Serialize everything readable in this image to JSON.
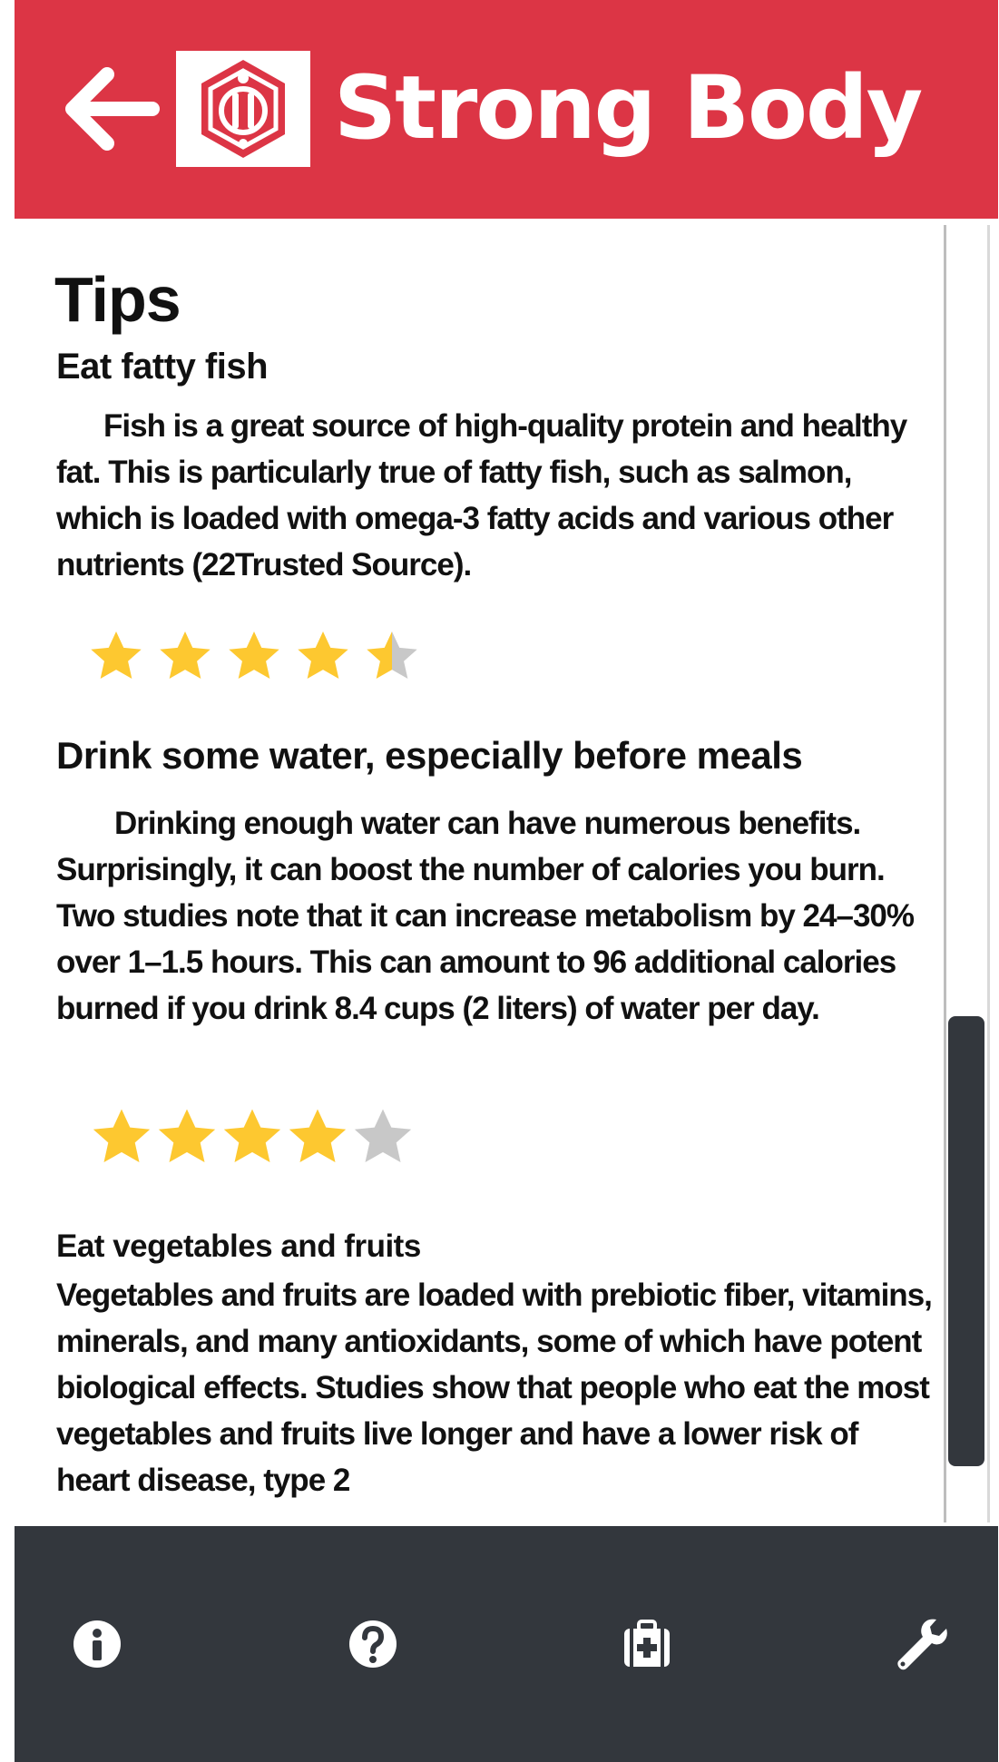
{
  "header": {
    "title": "Strong Body",
    "colors": {
      "bar": "#dc3545",
      "title": "#ffffff"
    },
    "icons": {
      "back": "arrow-left-icon",
      "logo": "strong-body-logo"
    }
  },
  "content": {
    "page_title": "Tips",
    "tips": [
      {
        "heading": "Eat fatty fish",
        "body": "Fish is a great source of high-quality protein and healthy fat. This is particularly true of fatty fish, such as salmon, which is loaded with omega-3 fatty acids and various other nutrients (22Trusted Source).",
        "rating": 4.5,
        "rating_max": 5
      },
      {
        "heading": "Drink some water, especially before meals",
        "body": "Drinking enough water can have numerous benefits. Surprisingly, it can boost the number of calories you burn. Two studies note that it can increase metabolism by 24–30% over 1–1.5 hours. This can amount to 96 additional calories burned if you drink 8.4 cups (2 liters) of water per day.",
        "rating": 4,
        "rating_max": 5
      },
      {
        "heading": "Eat vegetables and fruits",
        "body": "Vegetables and fruits are loaded with prebiotic fiber, vitamins, minerals, and many antioxidants, some of which have potent biological effects. Studies show that people who eat the most vegetables and fruits live longer and have a lower risk of heart disease, type 2"
      }
    ],
    "colors": {
      "star_filled": "#fdc830",
      "star_empty": "#c8c8c8"
    }
  },
  "bottom_nav": {
    "items": [
      {
        "icon": "info-icon"
      },
      {
        "icon": "question-icon"
      },
      {
        "icon": "first-aid-kit-icon"
      },
      {
        "icon": "wrench-icon"
      }
    ],
    "colors": {
      "bar": "#33373d",
      "icon": "#ffffff"
    }
  }
}
